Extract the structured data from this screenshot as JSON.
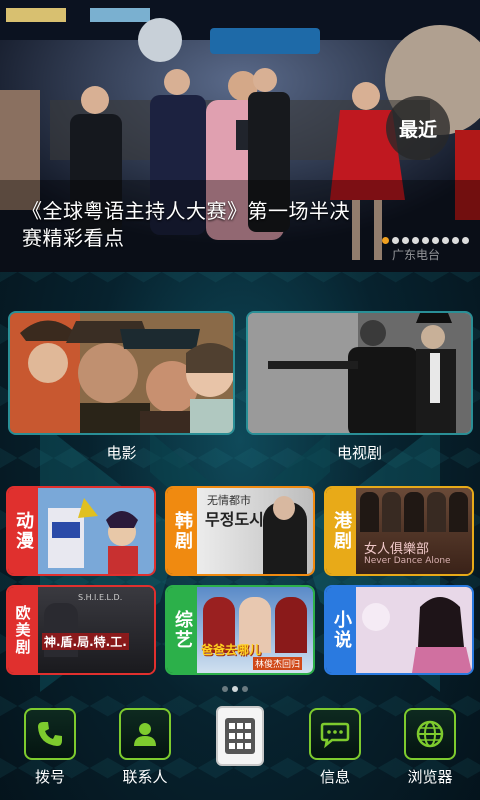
{
  "banner": {
    "caption": "《全球粤语主持人大赛》第一场半决赛精彩看点",
    "recent_button": "最近",
    "watermark": "广东电台",
    "slide_count": 9,
    "active_slide": 0
  },
  "categories_large": [
    {
      "label": "电影"
    },
    {
      "label": "电视剧"
    }
  ],
  "categories_small": [
    {
      "tag": "动漫",
      "color": "#e0302e"
    },
    {
      "tag": "韩剧",
      "color": "#f08a10"
    },
    {
      "tag": "港剧",
      "color": "#e8aa18"
    },
    {
      "tag": "欧美剧",
      "color": "#e0302e"
    },
    {
      "tag": "综艺",
      "color": "#2cb04a"
    },
    {
      "tag": "小说",
      "color": "#2a7ae0"
    }
  ],
  "small_card_texts": {
    "korean_title": "무정도시",
    "korean_chinese": "无情都市",
    "shield_title": "神.盾.局.特.工.",
    "shield_sub": "S.H.I.E.L.D.",
    "variety_title": "爸爸去哪儿",
    "variety_sub": "林俊杰回归",
    "hk_title": "女人俱樂部",
    "hk_sub": "Never Dance Alone"
  },
  "pager": {
    "count": 3,
    "active": 1
  },
  "dock": {
    "items": [
      {
        "label": "拨号",
        "icon": "phone-icon"
      },
      {
        "label": "联系人",
        "icon": "contacts-icon"
      },
      {
        "label": "",
        "icon": "app-grid-icon"
      },
      {
        "label": "信息",
        "icon": "message-icon"
      },
      {
        "label": "浏览器",
        "icon": "browser-icon"
      }
    ]
  },
  "colors": {
    "accent_green": "#7ecb2e",
    "card_border": "#2a8f96",
    "slide_active": "#f0a020"
  }
}
